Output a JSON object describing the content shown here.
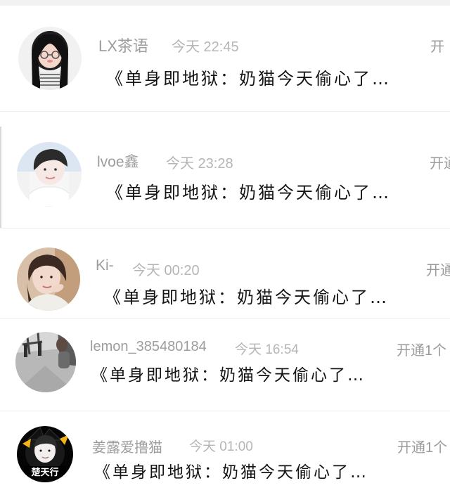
{
  "conversations": [
    {
      "name": "LX茶语",
      "time": "今天 22:45",
      "action": "开",
      "message": "《单身即地狱：奶猫今天偷心了…",
      "avatar_icon": "girl-with-glasses-avatar"
    },
    {
      "name": "lvoe鑫",
      "time": "今天 23:28",
      "action": "开通",
      "message": "《单身即地狱：奶猫今天偷心了…",
      "avatar_icon": "boy-portrait-avatar"
    },
    {
      "name": "Ki-",
      "time": "今天 00:20",
      "action": "开通",
      "message": "《单身即地狱：奶猫今天偷心了…",
      "avatar_icon": "girl-warm-photo-avatar"
    },
    {
      "name": "lemon_385480184",
      "time": "今天 16:54",
      "action": "开通1个",
      "message": "《单身即地狱：奶猫今天偷心了…",
      "avatar_icon": "street-photo-avatar"
    },
    {
      "name": "姜露爱撸猫",
      "time": "今天 01:00",
      "action": "开通1个",
      "message": "《单身即地狱：奶猫今天偷心了…",
      "avatar_icon": "witch-cat-badge-avatar",
      "avatar_text": "楚天行"
    }
  ]
}
